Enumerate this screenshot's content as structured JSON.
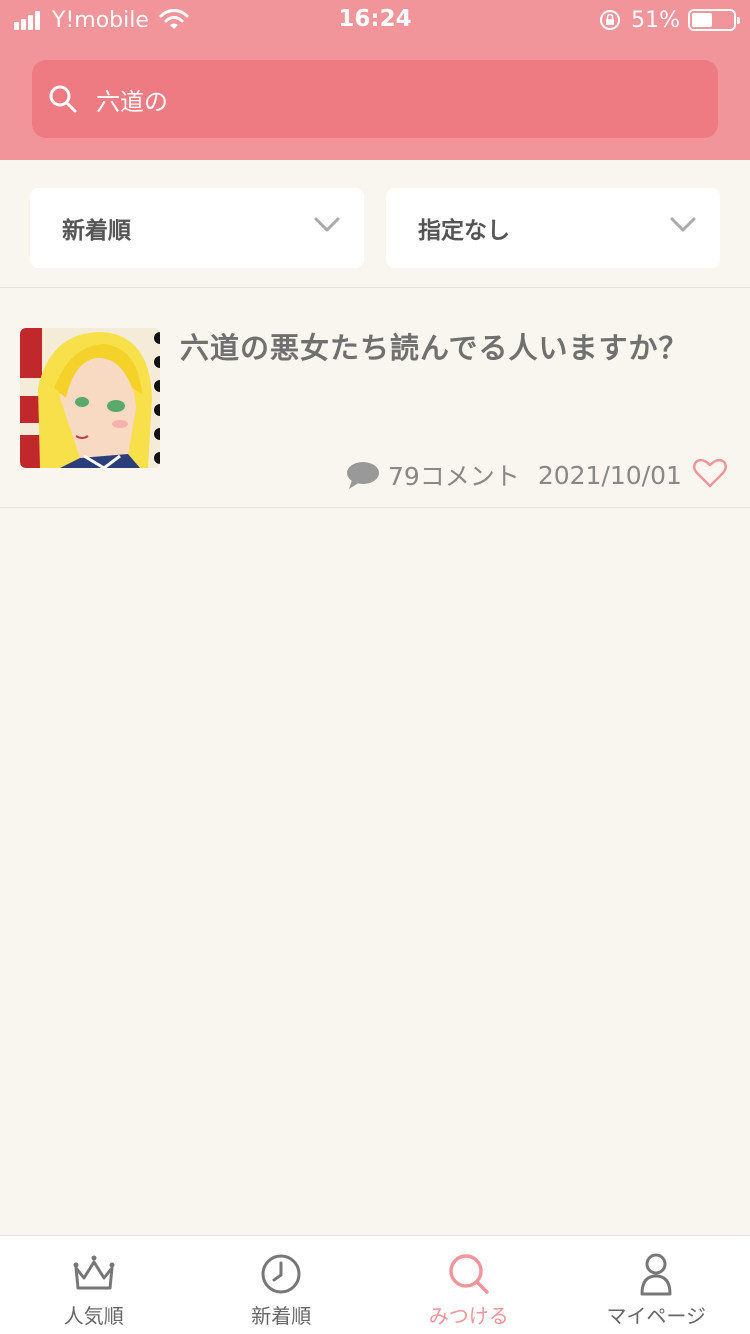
{
  "status_bar": {
    "carrier": "Y!mobile",
    "time": "16:24",
    "battery_percent": "51%",
    "battery_level": 0.51
  },
  "search": {
    "value": "六道の"
  },
  "filters": {
    "sort_label": "新着順",
    "genre_label": "指定なし"
  },
  "posts": [
    {
      "title": "六道の悪女たち読んでる人いますか？",
      "comments": "79コメント",
      "date": "2021/10/01"
    }
  ],
  "tabbar": {
    "tabs": [
      {
        "label": "人気順",
        "icon": "crown-icon",
        "active": false
      },
      {
        "label": "新着順",
        "icon": "clock-icon",
        "active": false
      },
      {
        "label": "みつける",
        "icon": "search-icon",
        "active": true
      },
      {
        "label": "マイページ",
        "icon": "person-icon",
        "active": false
      }
    ]
  },
  "colors": {
    "header": "#f1959b",
    "search_bg": "#ee7b81",
    "page_bg": "#f9f5ef",
    "accent": "#f1959b"
  }
}
